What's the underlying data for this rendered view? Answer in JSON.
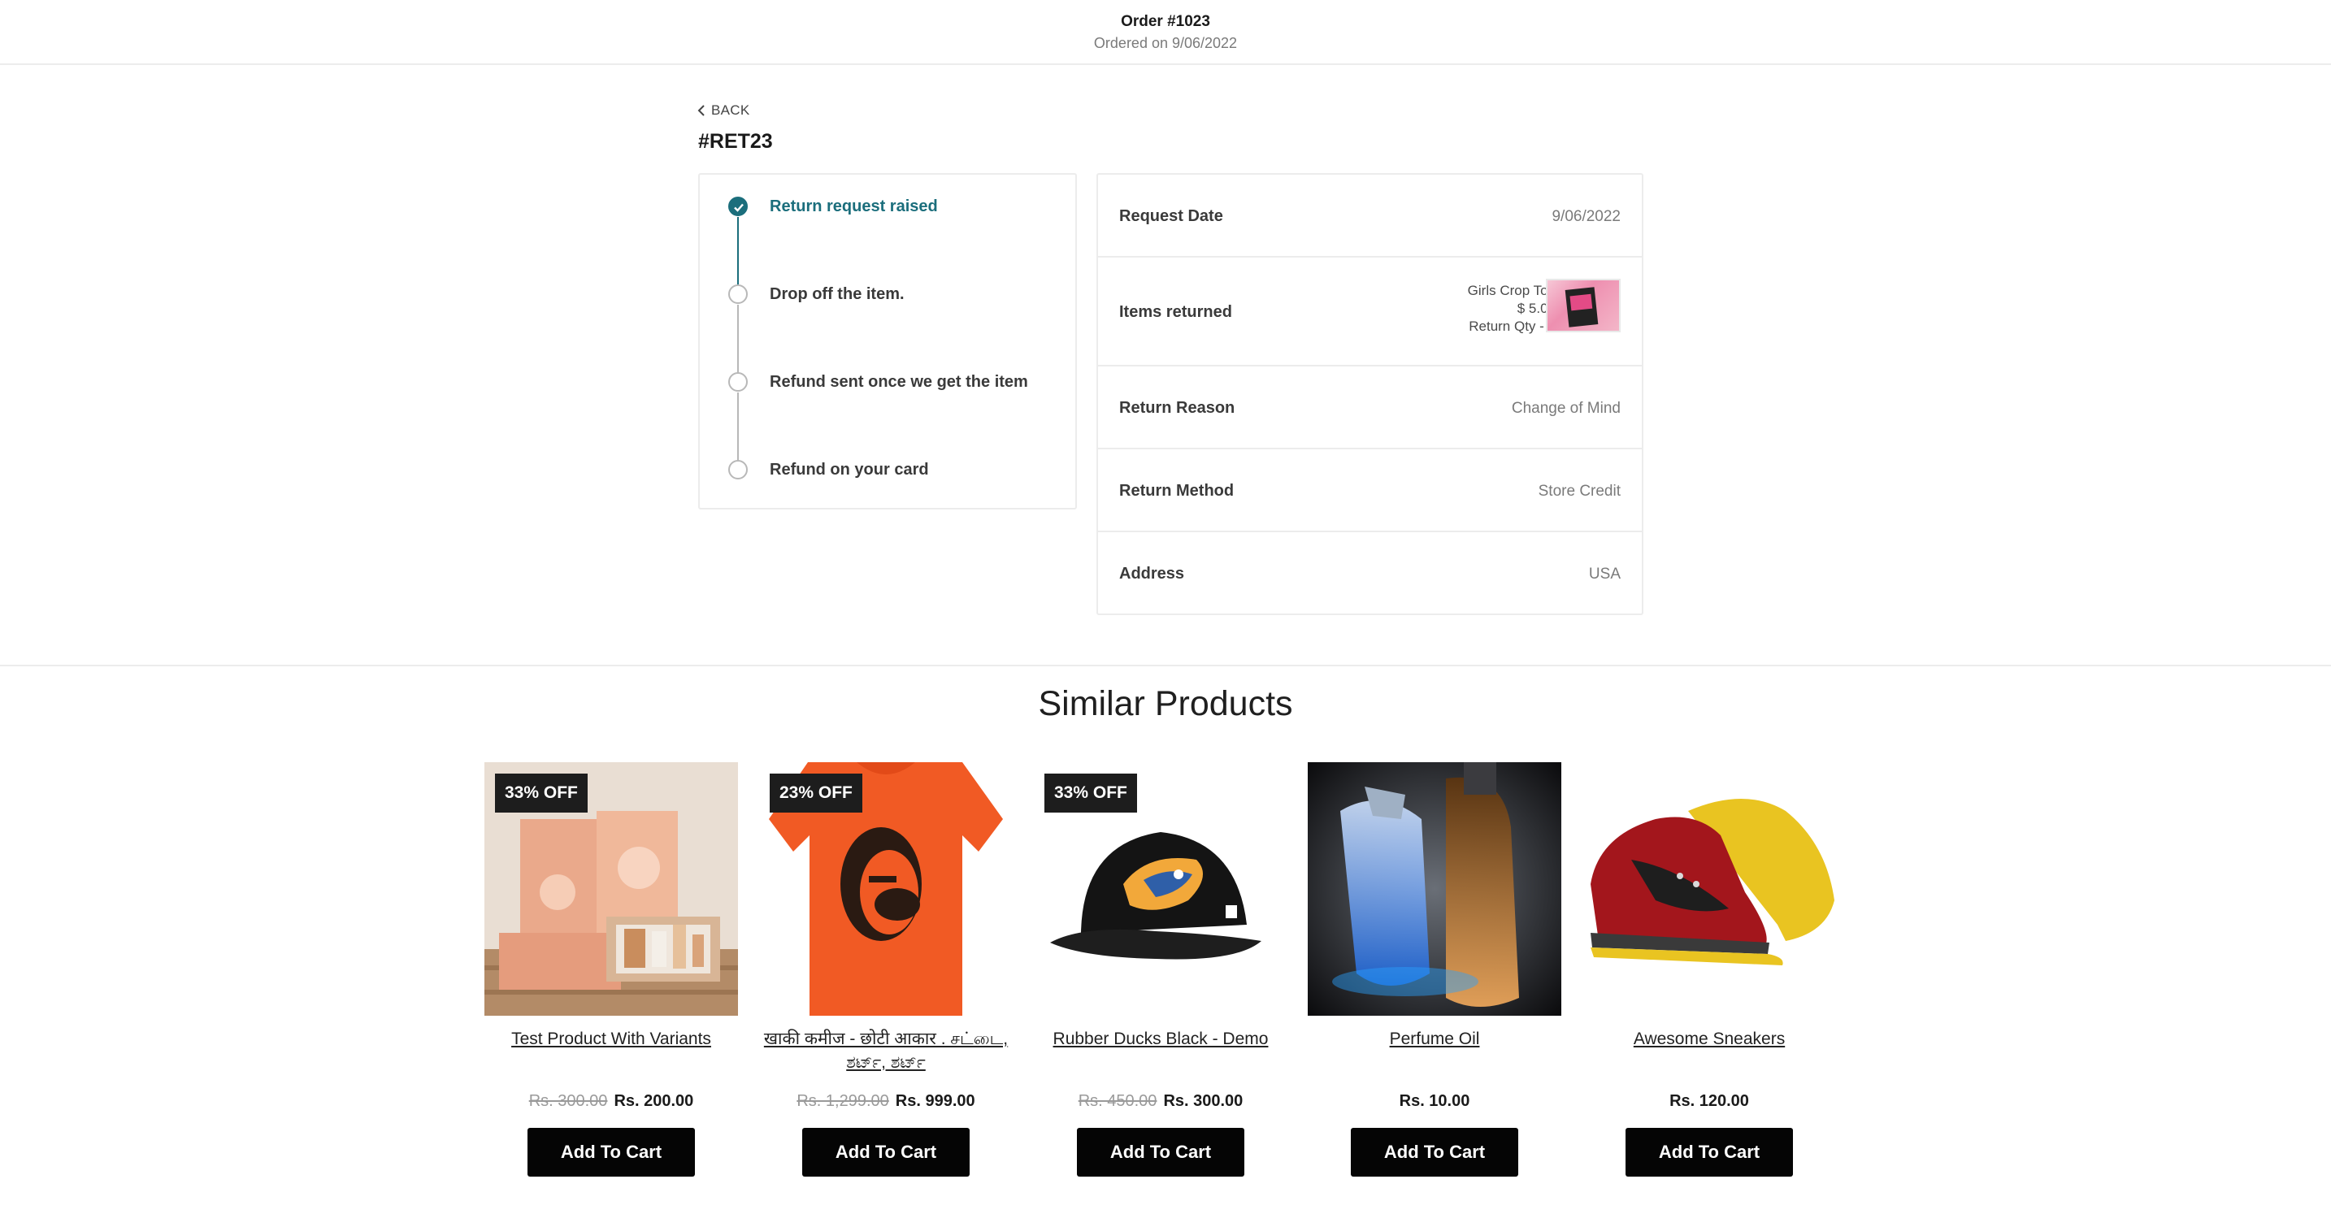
{
  "header": {
    "order_title": "Order #1023",
    "order_date": "Ordered on 9/06/2022"
  },
  "nav": {
    "back_label": "BACK"
  },
  "return": {
    "id": "#RET23"
  },
  "progress": {
    "accent_color": "#1b6e7c",
    "steps": [
      {
        "label": "Return request raised",
        "done": true
      },
      {
        "label": "Drop off the item.",
        "done": false
      },
      {
        "label": "Refund sent once we get the item",
        "done": false
      },
      {
        "label": "Refund on your card",
        "done": false
      }
    ]
  },
  "details": {
    "request_date": {
      "label": "Request Date",
      "value": "9/06/2022"
    },
    "items_returned": {
      "label": "Items returned",
      "item_name": "Girls Crop Top",
      "item_price": "$ 5.00",
      "item_qty": "Return Qty - 1"
    },
    "return_reason": {
      "label": "Return Reason",
      "value": "Change of Mind"
    },
    "return_method": {
      "label": "Return Method",
      "value": "Store Credit"
    },
    "address": {
      "label": "Address",
      "value": "USA"
    }
  },
  "similar": {
    "title": "Similar Products",
    "add_to_cart_label": "Add To Cart",
    "products": [
      {
        "title": "Test Product With Variants",
        "old_price": "Rs. 300.00",
        "price": "Rs. 200.00",
        "badge": "33% OFF"
      },
      {
        "title": "खाकी कमीज - छोटी आकार . சட்டை, ಶರ್ಟ್, ಶರ್ಟ್",
        "old_price": "Rs. 1,299.00",
        "price": "Rs. 999.00",
        "badge": "23% OFF"
      },
      {
        "title": "Rubber Ducks Black - Demo",
        "old_price": "Rs. 450.00",
        "price": "Rs. 300.00",
        "badge": "33% OFF"
      },
      {
        "title": "Perfume Oil",
        "old_price": "",
        "price": "Rs. 10.00",
        "badge": ""
      },
      {
        "title": "Awesome Sneakers",
        "old_price": "",
        "price": "Rs. 120.00",
        "badge": ""
      }
    ]
  }
}
